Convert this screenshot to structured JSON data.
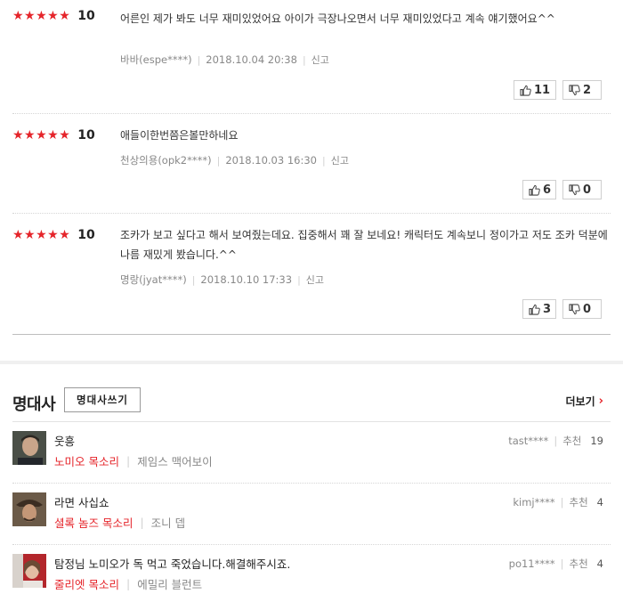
{
  "reviews": [
    {
      "stars": "★★★★★",
      "score": "10",
      "text": "어른인 제가 봐도 너무 재미있었어요 아이가 극장나오면서 너무 재미있었다고 계속 얘기했어요^^",
      "author": "바바(espe****)",
      "date": "2018.10.04 20:38",
      "report": "신고",
      "likes": "11",
      "dislikes": "2"
    },
    {
      "stars": "★★★★★",
      "score": "10",
      "text": "애들이한번쯤은볼만하네요",
      "author": "천상의용(opk2****)",
      "date": "2018.10.03 16:30",
      "report": "신고",
      "likes": "6",
      "dislikes": "0"
    },
    {
      "stars": "★★★★★",
      "score": "10",
      "text": "조카가 보고 싶다고 해서 보여줬는데요. 집중해서 꽤 잘 보네요! 캐릭터도 계속보니 정이가고 저도 조카 덕분에 나름 재밌게 봤습니다.^^",
      "author": "명랑(jyat****)",
      "date": "2018.10.10 17:33",
      "report": "신고",
      "likes": "3",
      "dislikes": "0"
    }
  ],
  "quotes_section": {
    "title": "명대사",
    "write_button": "명대사쓰기",
    "more_link": "더보기",
    "recommend_label": "추천",
    "items": [
      {
        "text": "웃흥",
        "role": "노미오 목소리",
        "actor": "제임스 맥어보이",
        "user": "tast****",
        "count": "19"
      },
      {
        "text": "라면 사십쇼",
        "role": "셜록 놈즈 목소리",
        "actor": "조니 뎁",
        "user": "kimj****",
        "count": "4"
      },
      {
        "text": "탐정님 노미오가 독 먹고 죽었습니다.해결해주시죠.",
        "role": "줄리엣 목소리",
        "actor": "에밀리 블런트",
        "user": "po11****",
        "count": "4"
      }
    ]
  },
  "colors": {
    "accent": "#e5242a",
    "muted": "#888888"
  },
  "icons": {
    "like": "thumbs-up-icon",
    "dislike": "thumbs-down-icon",
    "more": "chevron-right-icon"
  }
}
